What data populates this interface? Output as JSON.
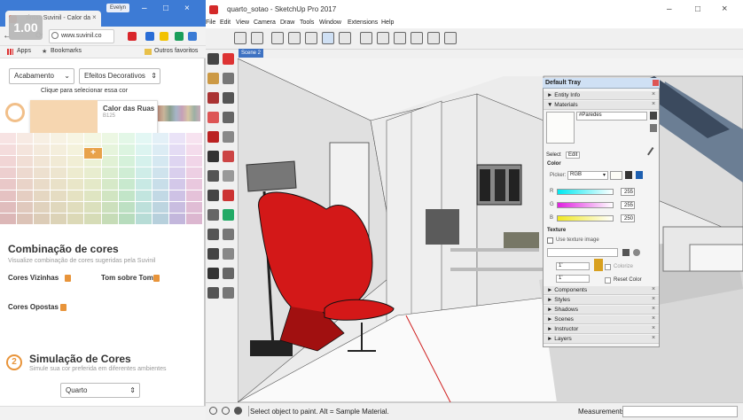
{
  "browser": {
    "tab_title": "Tintas Suvinil - Calor da",
    "tab_close": "×",
    "profile": "Evelyn",
    "zoom": "1.00",
    "url": "www.suvinil.co",
    "bookmarks": [
      "Apps",
      "Bookmarks",
      "Outros favoritos"
    ],
    "window_buttons": [
      "–",
      "□",
      "×"
    ],
    "ext_colors": [
      "#d9262b",
      "#2a6dd6",
      "#f2c200",
      "#1a9e5a",
      "#3a7bd5"
    ]
  },
  "suvinil": {
    "dropdown_1": "Acabamento",
    "dropdown_2": "Efeitos Decorativos",
    "hint": "Clique para selecionar essa cor",
    "color_name": "Calor das Ruas",
    "color_code": "B125",
    "color_hex": "#f6d6b0",
    "plus": "+",
    "combinations_title": "Combinação de cores",
    "combinations_sub": "Visualize combinação de cores sugeridas pela Suvinil",
    "neighbor_colors": "Cores Vizinhas",
    "tone_on_tone": "Tom sobre Tom",
    "opposite_colors": "Cores Opostas",
    "simulation_number": "2",
    "simulation_title": "Simulação de Cores",
    "simulation_sub": "Simule sua cor preferida em diferentes ambientes",
    "room_select": "Quarto",
    "accent_color": "#e8943a"
  },
  "sketchup": {
    "title": "quarto_sotao - SketchUp Pro 2017",
    "menus": [
      "File",
      "Edit",
      "View",
      "Camera",
      "Draw",
      "Tools",
      "Window",
      "Extensions",
      "Help"
    ],
    "scene_tab": "Scene 2",
    "status_text": "Select object to paint. Alt = Sample Material.",
    "measurements_label": "Measurements",
    "window_buttons": [
      "–",
      "□",
      "×"
    ]
  },
  "tray": {
    "title": "Default Tray",
    "sections_top": [
      "Entity Info",
      "Materials"
    ],
    "material_name": "#Paredes",
    "tab_select": "Select",
    "tab_edit": "Edit",
    "color_label": "Color",
    "picker_label": "Picker:",
    "picker_value": "RGB",
    "r_label": "R",
    "g_label": "G",
    "b_label": "B",
    "r_value": "255",
    "g_value": "255",
    "b_value": "250",
    "texture_label": "Texture",
    "use_texture": "Use texture image",
    "width_value": "1'",
    "height_value": "1'",
    "colorize": "Colorize",
    "reset_color": "Reset Color",
    "sections_bottom": [
      "Components",
      "Styles",
      "Shadows",
      "Scenes",
      "Instructor",
      "Layers"
    ],
    "close_x": "×"
  }
}
